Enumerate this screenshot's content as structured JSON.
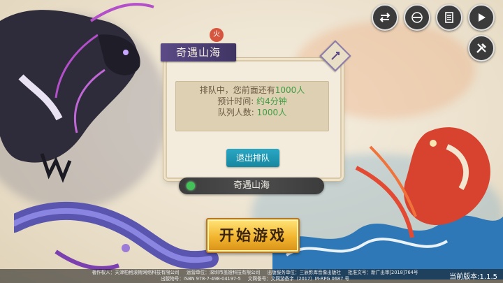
{
  "dialog": {
    "title": "奇遇山海",
    "seal": "火",
    "queue_prefix": "排队中，您前面还有",
    "queue_count": "1000人",
    "eta_label": "预计时间:",
    "eta_value": "约4分钟",
    "queue_size_label": "队列人数:",
    "queue_size_value": "1000人",
    "exit_button": "退出排队"
  },
  "server": {
    "name": "奇遇山海",
    "status_color": "#42c259"
  },
  "start_button": "开始游戏",
  "top_buttons": [
    "switch-account-icon",
    "menu-icon",
    "notice-icon",
    "play-video-icon"
  ],
  "tool_button": "tools-icon",
  "footer": {
    "line1": [
      "著作权人：天津柏格滚斯网络科技有限公司",
      "运营单位：深圳市盖娅科技有限公司",
      "出版服务单位：三辰影库音像出版社",
      "批准文号：新广出审[2018]764号"
    ],
    "line2": [
      "出版物号：ISBN 978-7-498-04197-5",
      "文网备号：文网游备字〔2017〕M-RPG 0687 号"
    ],
    "version": "当前版本:1.1.5"
  }
}
